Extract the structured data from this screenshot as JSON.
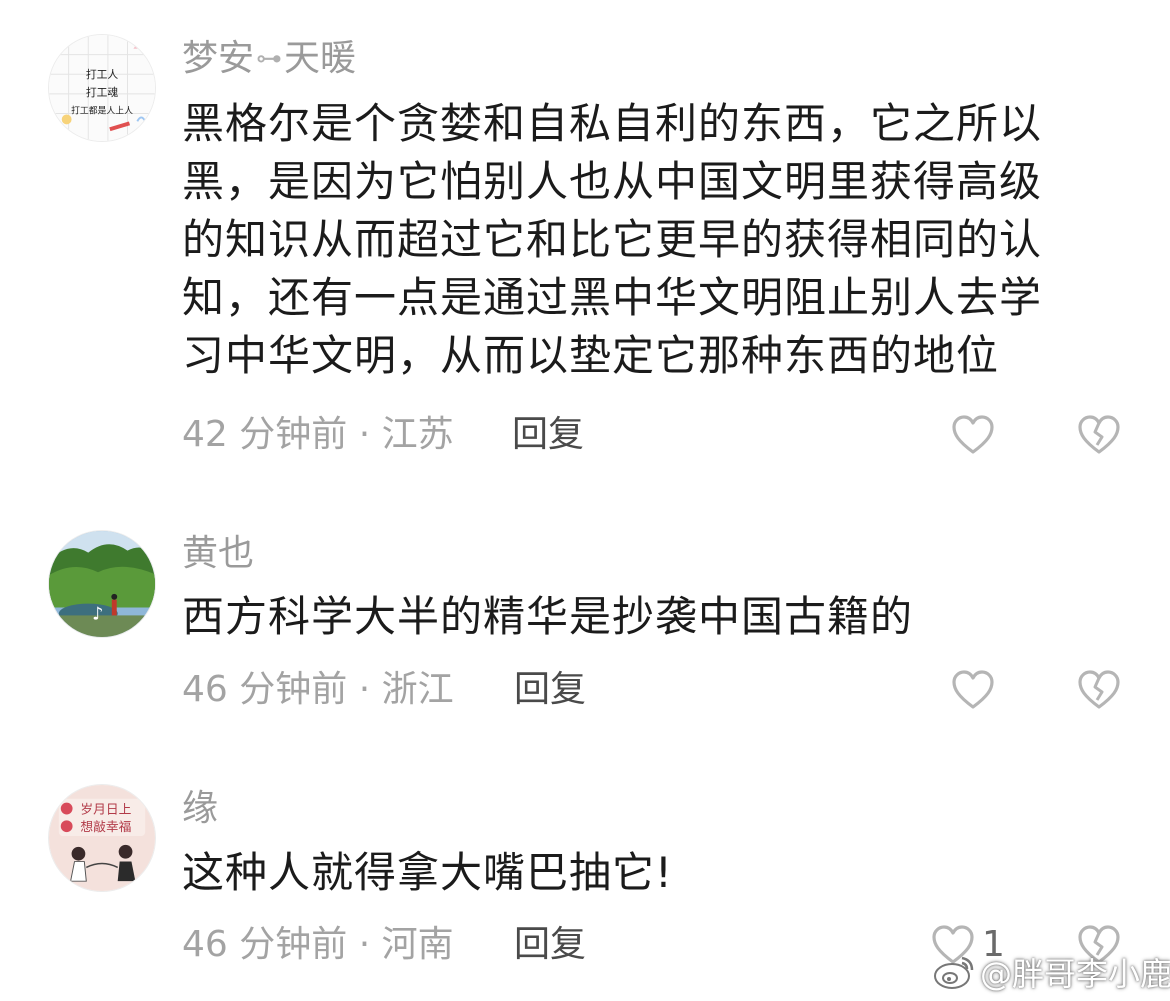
{
  "comments": [
    {
      "username_a": "梦安",
      "username_link": "⊶",
      "username_b": "天暖",
      "text_lines": [
        "黑格尔是个贪婪和自私自利的东西，它之所以",
        "黑，是因为它怕别人也从中国文明里获得高级",
        "的知识从而超过它和比它更早的获得相同的认",
        "知，还有一点是通过黑中华文明阻止别人去学",
        "习中华文明，从而以垫定它那种东西的地位"
      ],
      "meta": "42 分钟前 · 江苏",
      "reply_label": "回复",
      "avatar_text": [
        "打工人",
        "打工魂",
        "打工都是人上人"
      ]
    },
    {
      "username": "黄也",
      "text_lines": [
        "西方科学大半的精华是抄袭中国古籍的"
      ],
      "meta": "46 分钟前 · 浙江",
      "reply_label": "回复"
    },
    {
      "username": "缘",
      "text_lines": [
        "这种人就得拿大嘴巴抽它!"
      ],
      "meta": "46 分钟前 · 河南",
      "reply_label": "回复",
      "like_count": "1",
      "avatar_text": [
        "岁月日上",
        "想敲幸福"
      ]
    }
  ],
  "watermark": "@胖哥李小鹿",
  "icons": {
    "like": "heart-outline-icon",
    "dislike": "broken-heart-icon",
    "watermark": "weibo-logo-icon"
  },
  "colors": {
    "username": "#9a9a9a",
    "text": "#1b1b1b",
    "meta": "#a3a3a3",
    "reply": "#4a4a4a",
    "icon_stroke": "#b5b5b5"
  }
}
